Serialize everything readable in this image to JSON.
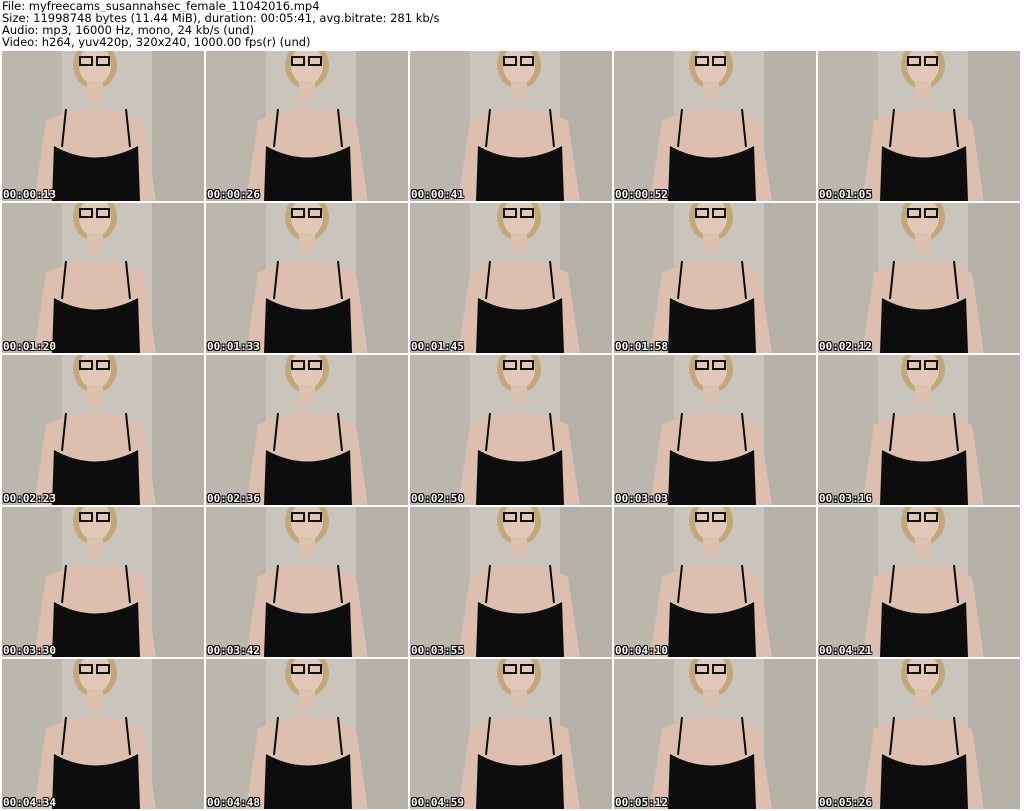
{
  "header": {
    "file_line": "File: myfreecams_susannahsec_female_11042016.mp4",
    "size_line": "Size: 11998748 bytes (11.44 MiB), duration: 00:05:41, avg.bitrate: 281 kb/s",
    "audio_line": "Audio: mp3, 16000 Hz, mono, 24 kb/s (und)",
    "video_line": "Video: h264, yuv420p, 320x240, 1000.00 fps(r) (und)"
  },
  "thumbnails": [
    {
      "timestamp": "00:00:13"
    },
    {
      "timestamp": "00:00:26"
    },
    {
      "timestamp": "00:00:41"
    },
    {
      "timestamp": "00:00:52"
    },
    {
      "timestamp": "00:01:05"
    },
    {
      "timestamp": "00:01:20"
    },
    {
      "timestamp": "00:01:33"
    },
    {
      "timestamp": "00:01:45"
    },
    {
      "timestamp": "00:01:58"
    },
    {
      "timestamp": "00:02:12"
    },
    {
      "timestamp": "00:02:23"
    },
    {
      "timestamp": "00:02:36"
    },
    {
      "timestamp": "00:02:50"
    },
    {
      "timestamp": "00:03:03"
    },
    {
      "timestamp": "00:03:16"
    },
    {
      "timestamp": "00:03:30"
    },
    {
      "timestamp": "00:03:42"
    },
    {
      "timestamp": "00:03:55"
    },
    {
      "timestamp": "00:04:10"
    },
    {
      "timestamp": "00:04:21"
    },
    {
      "timestamp": "00:04:34"
    },
    {
      "timestamp": "00:04:48"
    },
    {
      "timestamp": "00:04:59"
    },
    {
      "timestamp": "00:05:12"
    },
    {
      "timestamp": "00:05:26"
    }
  ],
  "colors": {
    "background": "#ffffff",
    "text": "#000000",
    "timestamp_text": "#ffffff",
    "timestamp_outline": "#000000"
  }
}
